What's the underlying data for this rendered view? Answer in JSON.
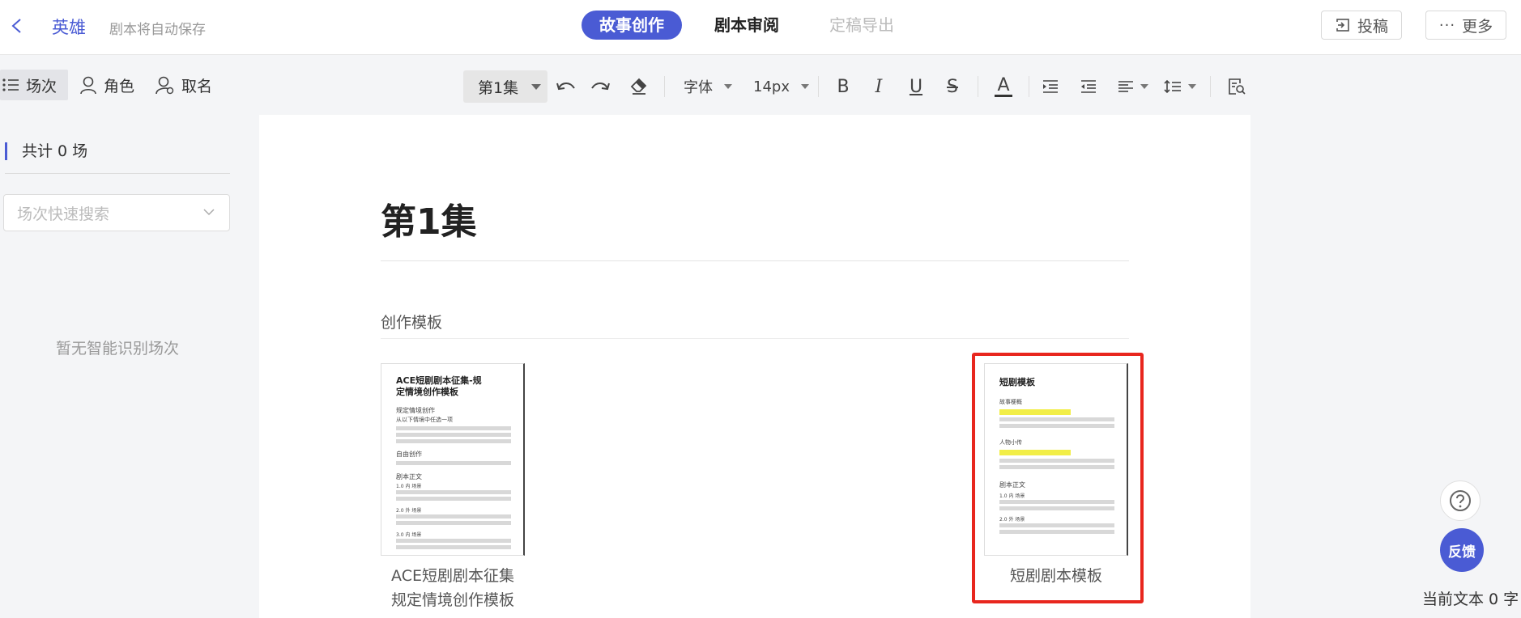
{
  "header": {
    "project_name": "英雄",
    "autosave_note": "剧本将自动保存",
    "tabs": [
      {
        "label": "故事创作",
        "state": "active"
      },
      {
        "label": "剧本审阅",
        "state": "normal"
      },
      {
        "label": "定稿导出",
        "state": "disabled"
      }
    ],
    "submit_label": "投稿",
    "more_label": "更多"
  },
  "left_tabs": {
    "scenes": "场次",
    "roles": "角色",
    "naming": "取名"
  },
  "toolbar": {
    "episode": "第1集",
    "font": "字体",
    "font_size": "14px",
    "bold": "B",
    "italic": "I",
    "underline": "U",
    "strike": "S",
    "color_letter": "A"
  },
  "scene_panel": {
    "count_text": "共计 0 场",
    "search_placeholder": "场次快速搜索",
    "empty_text": "暂无智能识别场次"
  },
  "editor": {
    "episode_title": "第1集",
    "templates_heading": "创作模板",
    "templates": [
      {
        "name_line1": "ACE短剧剧本征集",
        "name_line2": "规定情境创作模板",
        "thumb": {
          "title_line1": "ACE短剧剧本征集-规",
          "title_line2": "定情境创作模板",
          "lines": [
            "规定情境创作",
            "从以下情境中任选一项",
            "自由创作",
            "剧本正文",
            "1.0 内 场景",
            "2.0 外 场景",
            "3.0 内 场景"
          ]
        }
      },
      {
        "name_line1": "短剧剧本模板",
        "thumb": {
          "title": "短剧模板",
          "lines": [
            "故事梗概",
            "人物小传",
            "剧本正文",
            "1.0 内 场景",
            "2.0 外 场景"
          ]
        }
      }
    ]
  },
  "floaters": {
    "help_icon": "question-circle-icon",
    "feedback_label": "反馈",
    "word_count": "当前文本 0 字"
  },
  "colors": {
    "accent": "#4a5bd4",
    "highlight": "#e8261e",
    "thumb_highlight": "#f2ee47"
  }
}
